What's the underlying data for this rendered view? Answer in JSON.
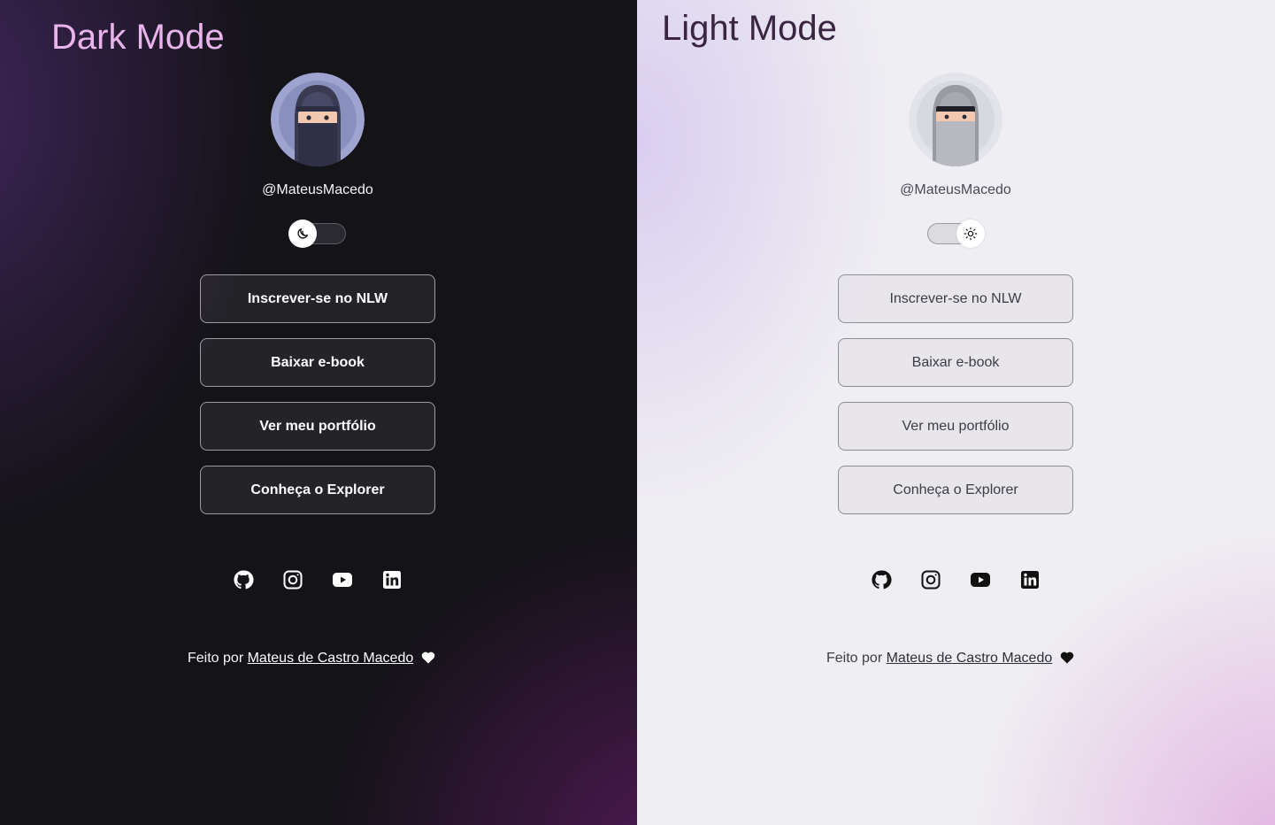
{
  "dark": {
    "mode_title": "Dark Mode",
    "profile": {
      "handle": "@MateusMacedo",
      "avatar_icon": "ninja-avatar-icon"
    },
    "toggle": {
      "state": "dark",
      "icon": "moon-icon"
    },
    "links": [
      {
        "label": "Inscrever-se no NLW"
      },
      {
        "label": "Baixar e-book"
      },
      {
        "label": "Ver meu portfólio"
      },
      {
        "label": "Conheça o Explorer"
      }
    ],
    "social": [
      "github-icon",
      "instagram-icon",
      "youtube-icon",
      "linkedin-icon"
    ],
    "footer": {
      "prefix": "Feito por ",
      "author": "Mateus de Castro Macedo",
      "icon": "heart-icon"
    }
  },
  "light": {
    "mode_title": "Light Mode",
    "profile": {
      "handle": "@MateusMacedo",
      "avatar_icon": "ninja-avatar-icon"
    },
    "toggle": {
      "state": "light",
      "icon": "sun-icon"
    },
    "links": [
      {
        "label": "Inscrever-se no NLW"
      },
      {
        "label": "Baixar e-book"
      },
      {
        "label": "Ver meu portfólio"
      },
      {
        "label": "Conheça o Explorer"
      }
    ],
    "social": [
      "github-icon",
      "instagram-icon",
      "youtube-icon",
      "linkedin-icon"
    ],
    "footer": {
      "prefix": "Feito por ",
      "author": "Mateus de Castro Macedo",
      "icon": "heart-icon"
    }
  },
  "colors": {
    "dark_bg": "#141318",
    "dark_accent": "#e9b3ec",
    "light_bg": "#efeef2",
    "light_title": "#3a2440"
  }
}
